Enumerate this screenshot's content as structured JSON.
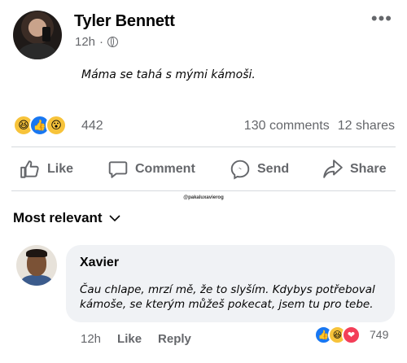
{
  "post": {
    "author": "Tyler Bennett",
    "time": "12h",
    "separator": "·",
    "text": "Máma se tahá s mými kámoši.",
    "reaction_count": "442",
    "comments_count": "130 comments",
    "shares_count": "12 shares",
    "more_label": "•••"
  },
  "actions": {
    "like": "Like",
    "comment": "Comment",
    "send": "Send",
    "share": "Share"
  },
  "watermark": "@pakaluxavierog",
  "sort": {
    "label": "Most relevant"
  },
  "comment": {
    "author": "Xavier",
    "text": "Čau chlape, mrzí mě, že to slyším. Kdybys potřeboval kámoše, se kterým můžeš pokecat, jsem tu pro tebe.",
    "time": "12h",
    "like": "Like",
    "reply": "Reply",
    "reaction_count": "749"
  },
  "icons": {
    "post_reactions": [
      "haha",
      "like",
      "wow"
    ],
    "comment_reactions": [
      "like",
      "haha",
      "love"
    ]
  },
  "colors": {
    "accent": "#1877f2",
    "muted": "#65676b",
    "bubble": "#f0f2f5"
  }
}
